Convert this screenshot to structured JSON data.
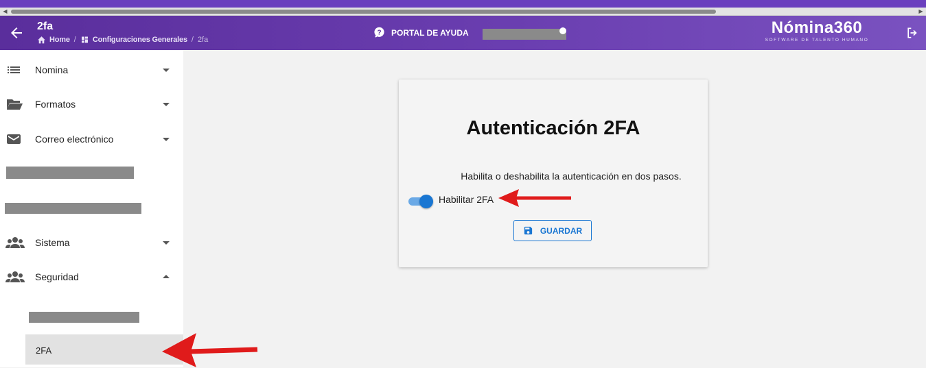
{
  "header": {
    "page_title": "2fa",
    "breadcrumb": [
      "Home",
      "Configuraciones Generales",
      "2fa"
    ],
    "help_label": "PORTAL DE AYUDA",
    "logo_name": "Nómina360",
    "logo_tagline": "SOFTWARE DE TALENTO HUMANO",
    "colors": {
      "bar": "#5a2e9c",
      "accent": "#1976d2"
    }
  },
  "sidebar": {
    "items": [
      {
        "label": "Nomina",
        "icon": "list-icon",
        "expanded": false
      },
      {
        "label": "Formatos",
        "icon": "folder-open-icon",
        "expanded": false
      },
      {
        "label": "Correo electrónico",
        "icon": "mail-icon",
        "expanded": false
      },
      {
        "label": "Sistema",
        "icon": "people-icon",
        "expanded": false
      },
      {
        "label": "Seguridad",
        "icon": "people-icon",
        "expanded": true
      }
    ],
    "active_sub_item": "2FA"
  },
  "card": {
    "title": "Autenticación 2FA",
    "description": "Habilita o deshabilita la autenticación en dos pasos.",
    "toggle_label": "Habilitar 2FA",
    "toggle_on": true,
    "save_label": "GUARDAR"
  }
}
